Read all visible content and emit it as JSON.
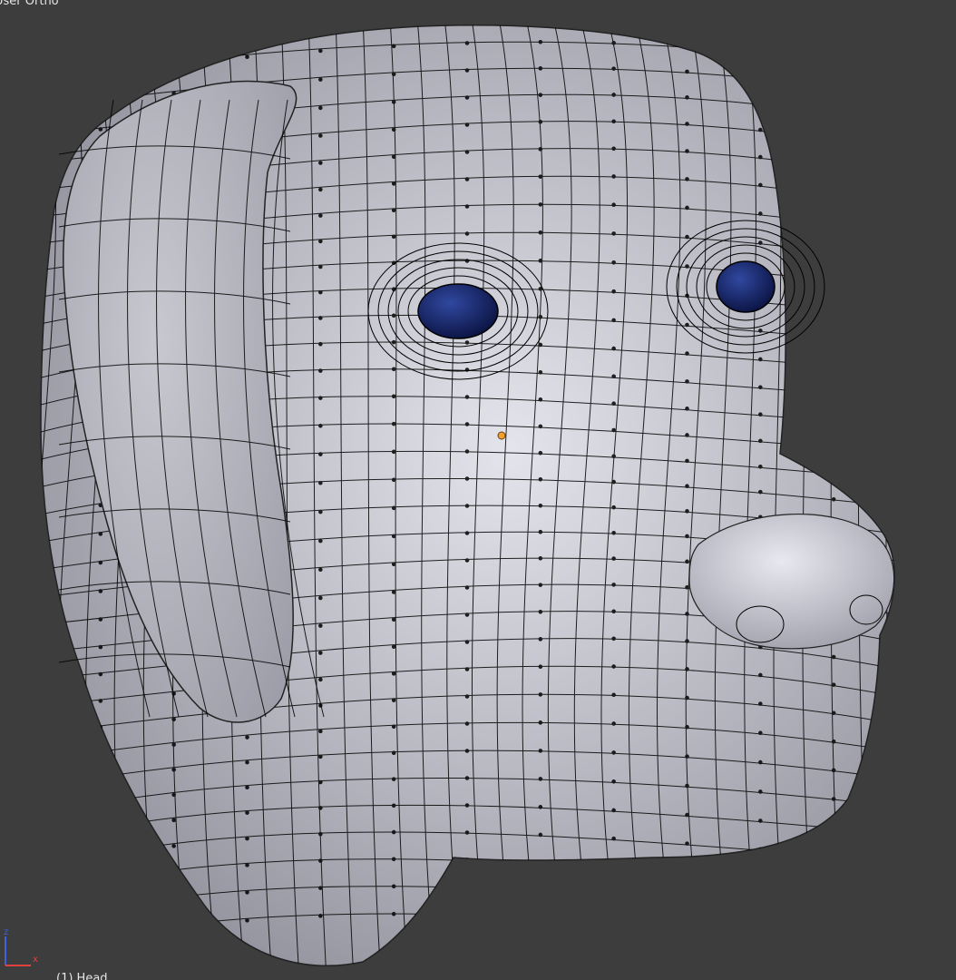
{
  "viewport": {
    "view_name": "User Ortho",
    "active_object": "(1) Head",
    "background_color": "#3d3d3d"
  },
  "mesh": {
    "name": "Head",
    "mode": "edit",
    "shading": "solid",
    "base_color": "#b8b8c0",
    "wire_color": "#000000",
    "eye_color": "#1a2a6c",
    "pivot_color": "#f0a030"
  },
  "axes": {
    "x_label": "x",
    "z_label": "z",
    "x_color": "#e04040",
    "z_color": "#4060e0"
  }
}
